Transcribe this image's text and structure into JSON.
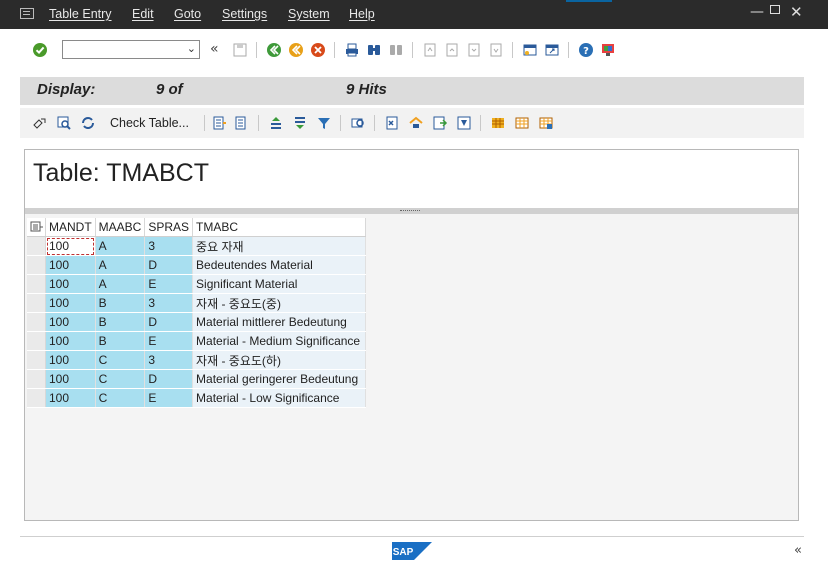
{
  "menubar": {
    "items": [
      "Table Entry",
      "Edit",
      "Goto",
      "Settings",
      "System",
      "Help"
    ],
    "window_controls": [
      "minimize-icon",
      "maximize-icon",
      "close-icon"
    ]
  },
  "toolbar": {
    "command_field_value": "",
    "icons": [
      "enter-icon",
      "back-icon",
      "exit-icon",
      "cancel-icon",
      "print-icon",
      "find-icon",
      "find-next-icon",
      "first-page-icon",
      "previous-page-icon",
      "next-page-icon",
      "last-page-icon",
      "create-session-icon",
      "shortcut-icon",
      "help-icon",
      "customize-layout-icon"
    ],
    "expand_glyph": "«"
  },
  "header": {
    "display_label": "Display:",
    "count": "9 of",
    "hits": "9 Hits"
  },
  "app_toolbar": {
    "check_table_label": "Check Table..."
  },
  "table": {
    "title": "Table: TMABCT",
    "columns": [
      "MANDT",
      "MAABC",
      "SPRAS",
      "TMABC"
    ],
    "rows": [
      [
        "100",
        "A",
        "3",
        "중요 자재"
      ],
      [
        "100",
        "A",
        "D",
        "Bedeutendes Material"
      ],
      [
        "100",
        "A",
        "E",
        "Significant Material"
      ],
      [
        "100",
        "B",
        "3",
        "자재 - 중요도(중)"
      ],
      [
        "100",
        "B",
        "D",
        "Material mittlerer Bedeutung"
      ],
      [
        "100",
        "B",
        "E",
        "Material - Medium Significance"
      ],
      [
        "100",
        "C",
        "3",
        "자재 - 중요도(하)"
      ],
      [
        "100",
        "C",
        "D",
        "Material geringerer Bedeutung"
      ],
      [
        "100",
        "C",
        "E",
        "Material - Low Significance"
      ]
    ]
  },
  "footer": {
    "logo_text": "SAP",
    "collapse_glyph": "«"
  },
  "colors": {
    "menubar_bg": "#2b2b2b",
    "key_cell_bg": "#a8dff0",
    "data_cell_bg": "#eaf2f8",
    "sap_blue": "#1a6fc4"
  }
}
